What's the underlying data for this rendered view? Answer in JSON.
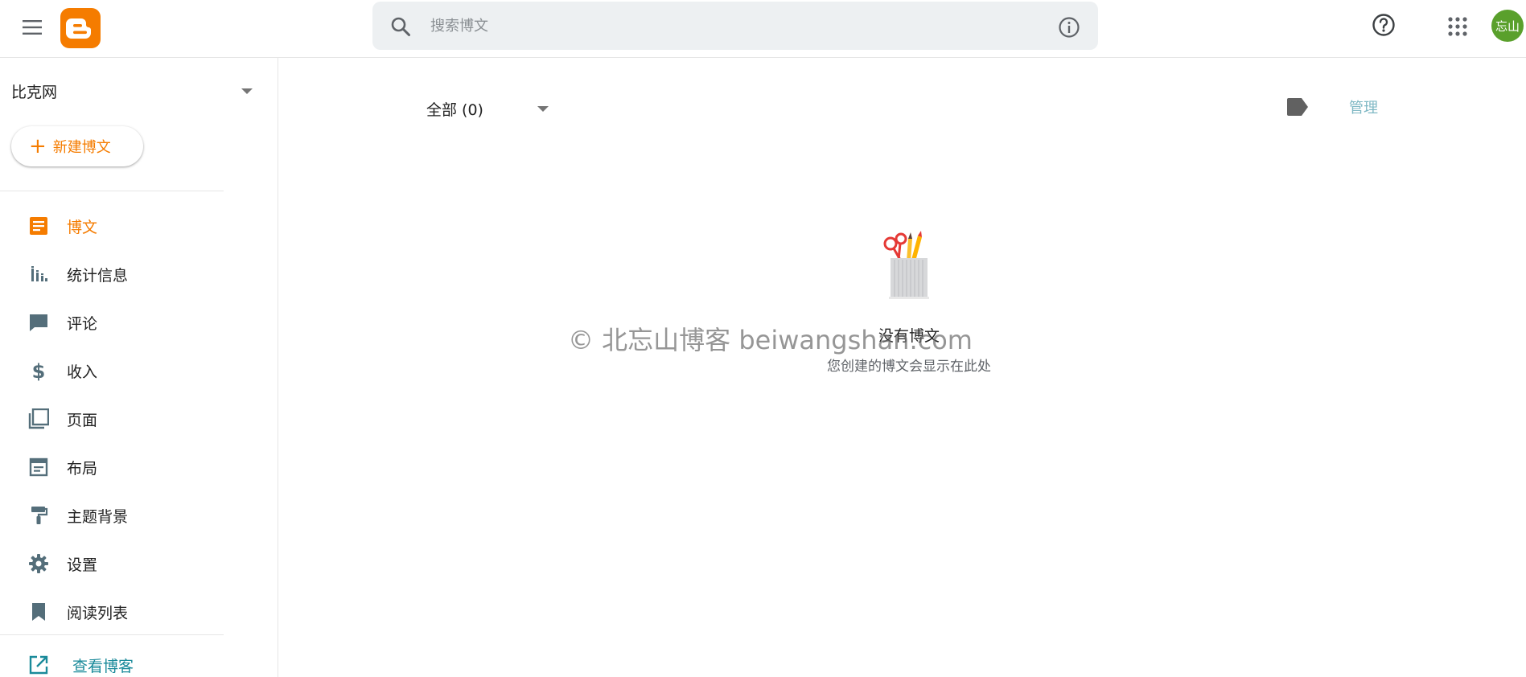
{
  "app": {
    "title": "Blogger"
  },
  "search": {
    "placeholder": "搜索博文"
  },
  "user": {
    "avatar_text": "忘山"
  },
  "sidebar": {
    "blog_name": "比克网",
    "new_post_label": "新建博文",
    "items": [
      {
        "label": "博文",
        "icon": "posts-icon"
      },
      {
        "label": "统计信息",
        "icon": "stats-icon"
      },
      {
        "label": "评论",
        "icon": "comment-icon"
      },
      {
        "label": "收入",
        "icon": "dollar-icon"
      },
      {
        "label": "页面",
        "icon": "pages-icon"
      },
      {
        "label": "布局",
        "icon": "layout-icon"
      },
      {
        "label": "主题背景",
        "icon": "paint-roller-icon"
      },
      {
        "label": "设置",
        "icon": "gear-icon"
      },
      {
        "label": "阅读列表",
        "icon": "bookmark-icon"
      }
    ],
    "view_blog_label": "查看博客"
  },
  "main": {
    "filter_label": "全部 (0)",
    "manage_label": "管理",
    "empty_title": "没有博文",
    "empty_subtitle": "您创建的博文会显示在此处"
  },
  "watermark": "© 北忘山博客 beiwangshan.com",
  "colors": {
    "accent": "#f57c00",
    "icon_gray": "#546e7a",
    "link_teal": "#1a8a9a",
    "search_bg": "#edf0f2",
    "avatar_bg": "#5aa02c"
  }
}
